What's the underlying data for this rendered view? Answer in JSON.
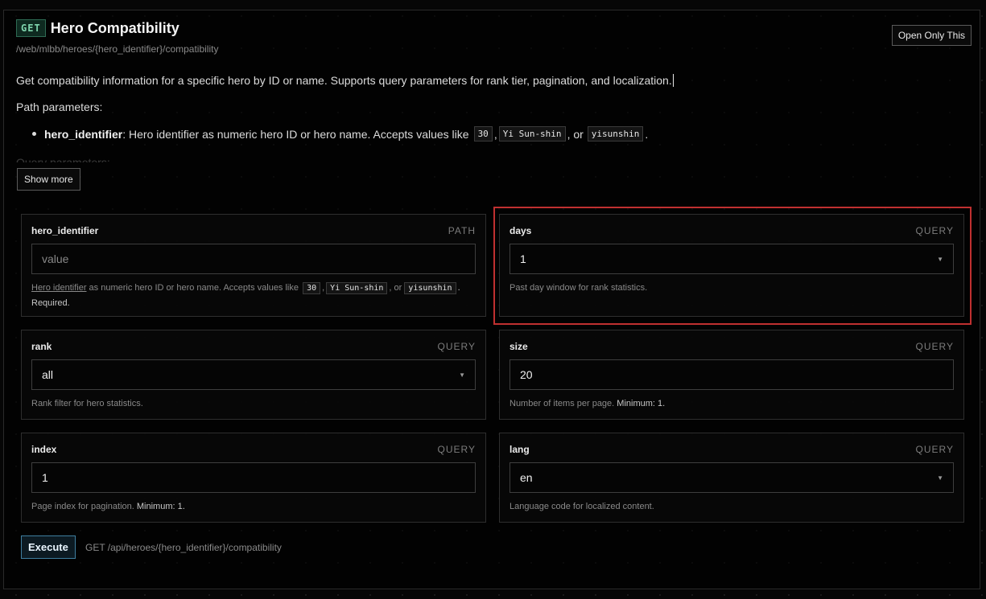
{
  "header": {
    "method": "GET",
    "title": "Hero Compatibility",
    "path": "/web/mlbb/heroes/{hero_identifier}/compatibility",
    "open_only_label": "Open Only This"
  },
  "description": "Get compatibility information for a specific hero by ID or name. Supports query parameters for rank tier, pagination, and localization.",
  "path_params_label": "Path parameters:",
  "path_param_item": {
    "name": "hero_identifier",
    "text": ": Hero identifier as numeric hero ID or hero name. Accepts values like",
    "ex1": "30",
    "ex2": "Yi Sun-shin",
    "or": ", or",
    "ex3": "yisunshin",
    "end": "."
  },
  "faded_text": "Query parameters:",
  "show_more_label": "Show more",
  "params": {
    "hero_identifier": {
      "name": "hero_identifier",
      "location": "PATH",
      "placeholder": "value",
      "help_link": "Hero identifier",
      "help_text": " as numeric hero ID or hero name. Accepts values like",
      "ex1": "30",
      "ex2": "Yi Sun-shin",
      "or": ", or",
      "ex3": "yisunshin",
      "required": ". Required."
    },
    "days": {
      "name": "days",
      "location": "QUERY",
      "value": "1",
      "help": "Past day window for rank statistics."
    },
    "rank": {
      "name": "rank",
      "location": "QUERY",
      "value": "all",
      "help": "Rank filter for hero statistics."
    },
    "size": {
      "name": "size",
      "location": "QUERY",
      "value": "20",
      "help": "Number of items per page.",
      "min": "Minimum: 1."
    },
    "index": {
      "name": "index",
      "location": "QUERY",
      "value": "1",
      "help": "Page index for pagination.",
      "min": "Minimum: 1."
    },
    "lang": {
      "name": "lang",
      "location": "QUERY",
      "value": "en",
      "help": "Language code for localized content."
    }
  },
  "execute": {
    "label": "Execute",
    "path": "GET /api/heroes/{hero_identifier}/compatibility"
  },
  "colors": {
    "accent_green": "#7fd4ad",
    "highlight_red": "#c03030",
    "execute_border": "#3f7fa0"
  }
}
